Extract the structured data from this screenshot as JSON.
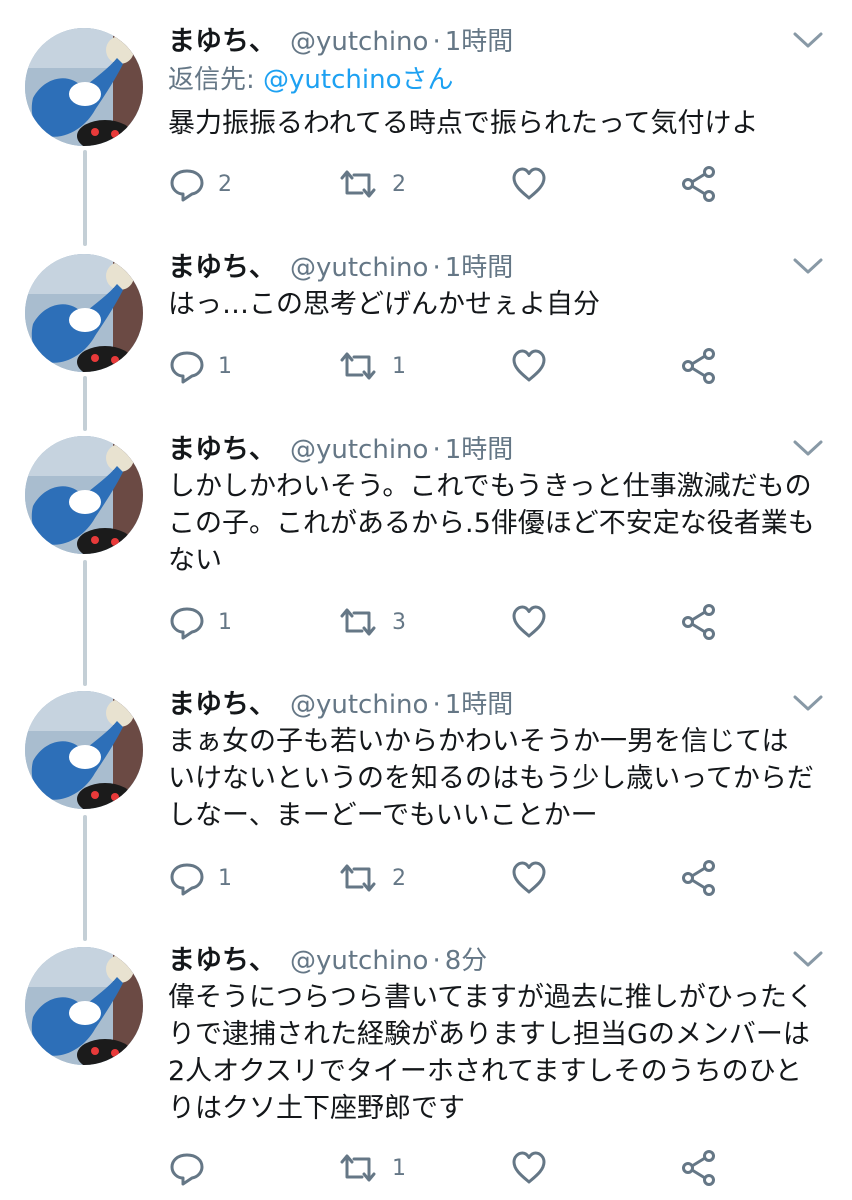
{
  "tweets": [
    {
      "name": "まゆち、",
      "handle": "@yutchino",
      "dot": "·",
      "time": "1時間",
      "reply_label": "返信先: ",
      "reply_handle": "@yutchinoさん",
      "lines": [
        "暴力振振るわれてる時点で振られたって気付けよ"
      ],
      "replies": "2",
      "retweets": "2",
      "likes": ""
    },
    {
      "name": "まゆち、",
      "handle": "@yutchino",
      "dot": "·",
      "time": "1時間",
      "lines": [
        "はっ…この思考どげんかせぇよ自分"
      ],
      "replies": "1",
      "retweets": "1",
      "likes": ""
    },
    {
      "name": "まゆち、",
      "handle": "@yutchino",
      "dot": "·",
      "time": "1時間",
      "lines": [
        "しかしかわいそう。これでもうきっと仕事激減だもの",
        "この子。これがあるから.5俳優ほど不安定な役者業も",
        "ない"
      ],
      "replies": "1",
      "retweets": "3",
      "likes": ""
    },
    {
      "name": "まゆち、",
      "handle": "@yutchino",
      "dot": "·",
      "time": "1時間",
      "lines": [
        "まぁ女の子も若いからかわいそうか一男を信じては",
        "いけないというのを知るのはもう少し歳いってからだ",
        "しなー、まーどーでもいいことかー"
      ],
      "replies": "1",
      "retweets": "2",
      "likes": ""
    },
    {
      "name": "まゆち、",
      "handle": "@yutchino",
      "dot": "·",
      "time": "8分",
      "lines": [
        "偉そうにつらつら書いてますが過去に推しがひったく",
        "りで逮捕された経験がありますし担当Gのメンバーは",
        "2人オクスリでタイーホされてますしそのうちのひと",
        "りはクソ土下座野郎です"
      ],
      "replies": "",
      "retweets": "1",
      "likes": ""
    }
  ],
  "icons": {
    "reply": "reply-icon",
    "retweet": "retweet-icon",
    "like": "like-icon",
    "share": "share-icon",
    "menu": "chevron-down-icon",
    "avatar": "avatar-image"
  },
  "colors": {
    "name": "#14171a",
    "secondary": "#657786",
    "link": "#1da1f2",
    "thread_line": "#c4cfd6",
    "icon": "#657786"
  }
}
